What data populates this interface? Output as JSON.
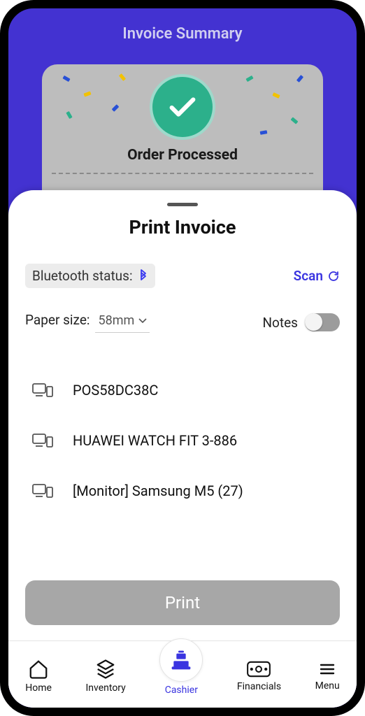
{
  "header": {
    "title": "Invoice Summary"
  },
  "receipt": {
    "status_text": "Order Processed"
  },
  "sheet": {
    "title": "Print Invoice",
    "bt_status_label": "Bluetooth status:",
    "scan_label": "Scan",
    "paper_label": "Paper size:",
    "paper_value": "58mm",
    "notes_label": "Notes",
    "notes_on": false,
    "devices": [
      {
        "name": "POS58DC38C"
      },
      {
        "name": "HUAWEI WATCH FIT 3-886"
      },
      {
        "name": "[Monitor] Samsung M5 (27)"
      }
    ],
    "print_label": "Print"
  },
  "nav": {
    "items": [
      {
        "label": "Home"
      },
      {
        "label": "Inventory"
      },
      {
        "label": "Cashier"
      },
      {
        "label": "Financials"
      },
      {
        "label": "Menu"
      }
    ],
    "active_index": 2
  }
}
